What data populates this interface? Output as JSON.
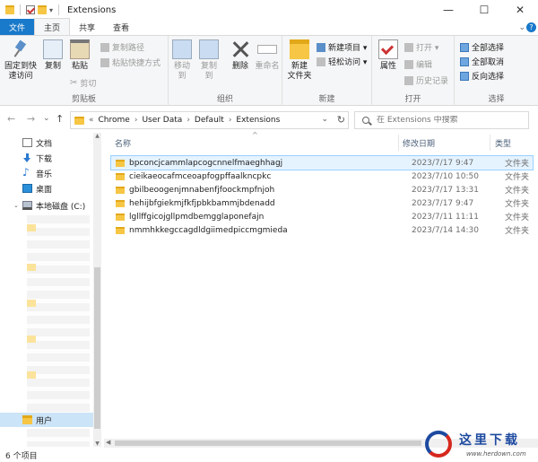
{
  "window": {
    "title": "Extensions",
    "controls": {
      "minimize": "—",
      "maximize": "☐",
      "close": "✕"
    }
  },
  "ribbon_tabs": [
    {
      "label": "文件"
    },
    {
      "label": "主页"
    },
    {
      "label": "共享"
    },
    {
      "label": "查看"
    }
  ],
  "ribbon": {
    "clipboard": {
      "label": "剪贴板",
      "pin": "固定到快\n速访问",
      "copy": "复制",
      "paste": "粘贴",
      "copy_path": "复制路径",
      "paste_shortcut": "粘贴快捷方式",
      "cut": "剪切"
    },
    "organize": {
      "label": "组织",
      "move_to": "移动到",
      "copy_to": "复制到",
      "delete": "删除",
      "rename": "重命名"
    },
    "new": {
      "label": "新建",
      "new_folder": "新建\n文件夹",
      "new_item": "新建项目 ▾",
      "easy_access": "轻松访问 ▾"
    },
    "open": {
      "label": "打开",
      "properties": "属性",
      "open": "打开 ▾",
      "edit": "编辑",
      "history": "历史记录"
    },
    "select": {
      "label": "选择",
      "select_all": "全部选择",
      "select_none": "全部取消",
      "invert": "反向选择"
    }
  },
  "navigation": {
    "back": "←",
    "forward": "→",
    "recent": "⌄",
    "up": "↑"
  },
  "address": {
    "prefix": "«",
    "crumbs": [
      "Chrome",
      "User Data",
      "Default",
      "Extensions"
    ],
    "dropdown": "⌄",
    "refresh": "↻"
  },
  "search": {
    "placeholder": "在 Extensions 中搜索"
  },
  "nav_pane": {
    "items": [
      {
        "label": "文档",
        "icon": "document-icon"
      },
      {
        "label": "下载",
        "icon": "download-icon"
      },
      {
        "label": "音乐",
        "icon": "music-icon"
      },
      {
        "label": "桌面",
        "icon": "desktop-icon"
      },
      {
        "label": "本地磁盘 (C:)",
        "icon": "drive-icon"
      },
      {
        "label": "用户",
        "icon": "folder-icon"
      }
    ]
  },
  "columns": {
    "name": "名称",
    "date": "修改日期",
    "type": "类型"
  },
  "files": [
    {
      "name": "bpconcjcammlapcogcnnelfmaeghhagj",
      "date": "2023/7/17 9:47",
      "type": "文件夹"
    },
    {
      "name": "cieikaeocafmceoapfogpffaalkncpkc",
      "date": "2023/7/10 10:50",
      "type": "文件夹"
    },
    {
      "name": "gbilbeoogenjmnabenfjfoockmpfnjoh",
      "date": "2023/7/17 13:31",
      "type": "文件夹"
    },
    {
      "name": "hehijbfgiekmjfkfjpbkbammjbdenadd",
      "date": "2023/7/17 9:47",
      "type": "文件夹"
    },
    {
      "name": "lgllffgicojgllpmdbemgglaponefajn",
      "date": "2023/7/11 11:11",
      "type": "文件夹"
    },
    {
      "name": "nmmhkkegccagdldgiimedpiccmgmieda",
      "date": "2023/7/14 14:30",
      "type": "文件夹"
    }
  ],
  "status": {
    "count": "6 个项目"
  },
  "watermark": {
    "brand": "这里下载",
    "site": "www.herdown.com"
  }
}
